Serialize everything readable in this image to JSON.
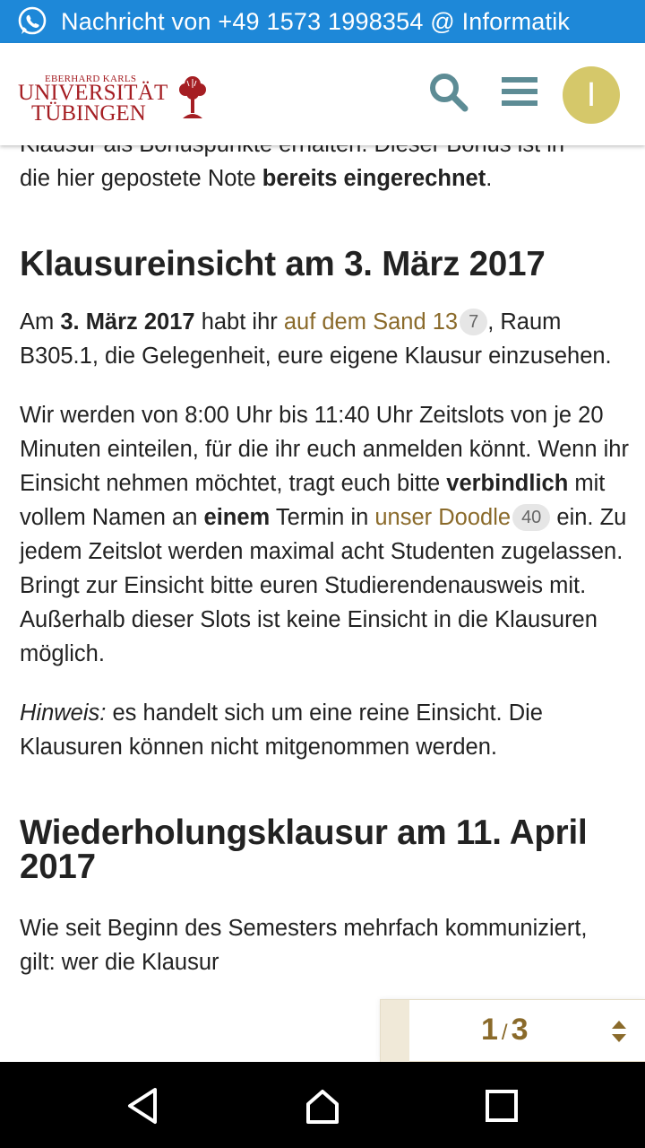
{
  "notification": {
    "icon": "whatsapp-icon",
    "text": "Nachricht von +49 1573 1998354 @ Informatik"
  },
  "header": {
    "logo_line1": "EBERHARD KARLS",
    "logo_line2": "UNIVERSITÄT",
    "logo_line3": "TÜBINGEN",
    "search_icon": "search-icon",
    "menu_icon": "hamburger-menu-icon",
    "avatar_letter": "I",
    "avatar_color": "#d5c86a"
  },
  "post": {
    "clipped_line": "Klausur als Bonuspunkte erhalten. Dieser Bonus ist in",
    "intro": {
      "before": "die hier gepostete Note ",
      "bold": "bereits eingerechnet",
      "after": "."
    },
    "section1": {
      "heading": "Klausureinsicht am 3. März 2017",
      "p1": {
        "t1": "Am ",
        "b1": "3. März 2017",
        "t2": " habt ihr ",
        "link": "auf dem Sand 13",
        "badge": "7",
        "t3": ", Raum B305.1, die Gelegenheit, eure eigene Klausur einzusehen."
      },
      "p2": {
        "t1": "Wir werden von 8:00 Uhr bis 11:40 Uhr Zeitslots von je 20 Minuten einteilen, für die ihr euch anmelden könnt. Wenn ihr Einsicht nehmen möchtet, tragt euch bitte ",
        "b1": "verbindlich",
        "t2": " mit vollem Namen an ",
        "b2": "einem",
        "t3": " Termin in ",
        "link": "unser Doodle",
        "badge": "40",
        "t4": " ein. Zu jedem Zeitslot werden maximal acht Studenten zugelassen. Bringt zur Einsicht bitte euren Studierendenausweis mit. Außerhalb dieser Slots ist keine Einsicht in die Klausuren möglich."
      },
      "p3": {
        "em": "Hinweis:",
        "text": " es handelt sich um eine reine Einsicht. Die Klausuren können nicht mitgenommen werden."
      }
    },
    "section2": {
      "heading": "Wiederholungsklausur am 11. April 2017",
      "p1": "Wie seit Beginn des Semesters mehrfach kommuniziert, gilt: wer die Klausur"
    }
  },
  "timeline": {
    "current": "1",
    "separator": "/",
    "total": "3",
    "accent": "#8a6a2a"
  },
  "navbar": {
    "back_icon": "back-triangle-icon",
    "home_icon": "home-icon",
    "recent_icon": "recent-apps-icon"
  }
}
